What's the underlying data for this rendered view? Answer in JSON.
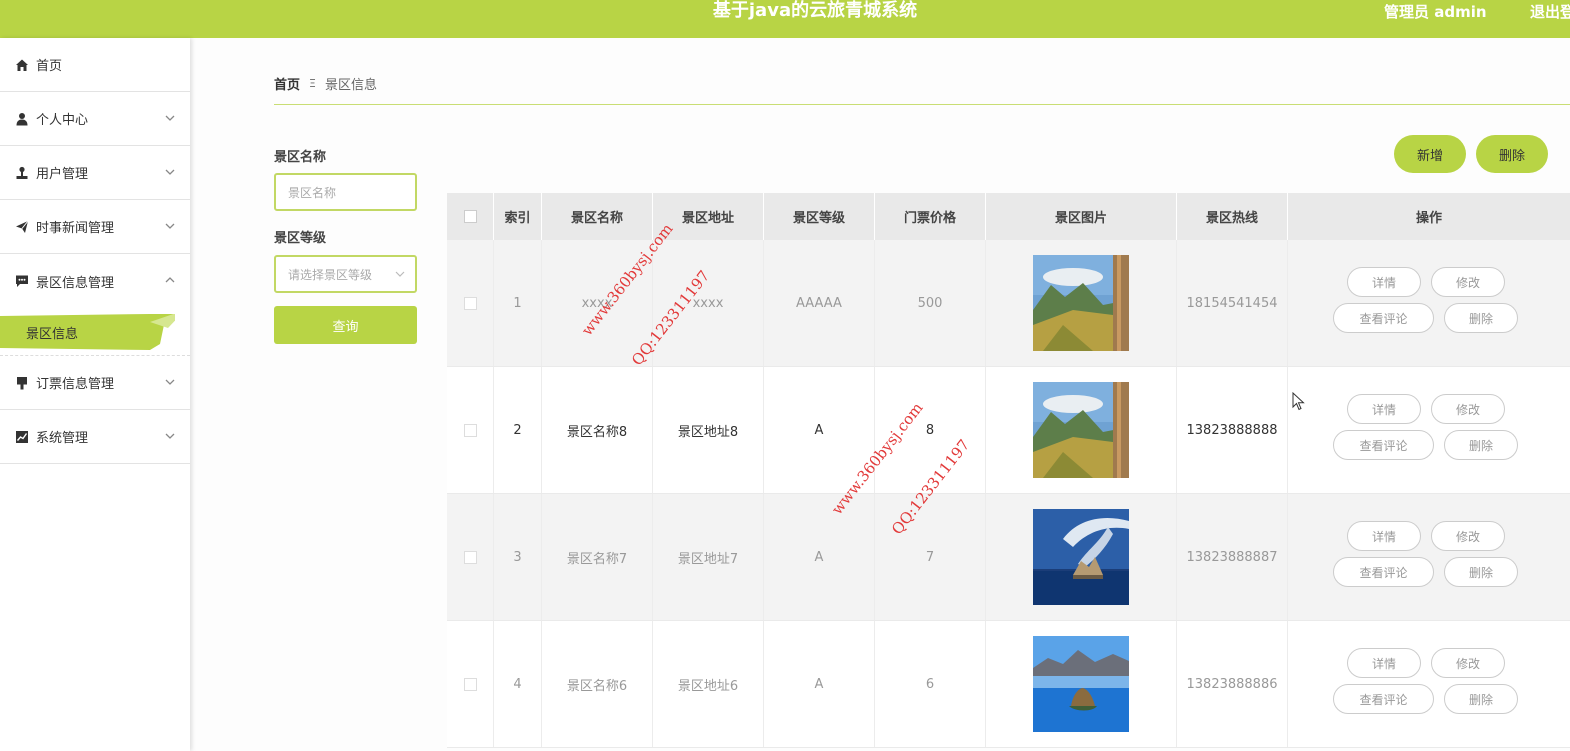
{
  "header": {
    "title": "基于java的云旅青城系统",
    "admin": "管理员 admin",
    "logout": "退出登"
  },
  "sidebar": {
    "items": [
      {
        "label": "首页",
        "icon": "home-icon"
      },
      {
        "label": "个人中心",
        "icon": "user-icon"
      },
      {
        "label": "用户管理",
        "icon": "user-manage-icon"
      },
      {
        "label": "时事新闻管理",
        "icon": "paper-plane-icon"
      },
      {
        "label": "景区信息管理",
        "icon": "chat-icon"
      },
      {
        "label": "订票信息管理",
        "icon": "brush-icon"
      },
      {
        "label": "系统管理",
        "icon": "chart-icon"
      }
    ],
    "sub_active": "景区信息"
  },
  "breadcrumb": {
    "home": "首页",
    "separator": "Ξ",
    "current": "景区信息"
  },
  "search": {
    "name_label": "景区名称",
    "name_placeholder": "景区名称",
    "level_label": "景区等级",
    "level_placeholder": "请选择景区等级",
    "query_button": "查询"
  },
  "actions": {
    "add": "新增",
    "delete": "删除"
  },
  "table": {
    "headers": [
      "索引",
      "景区名称",
      "景区地址",
      "景区等级",
      "门票价格",
      "景区图片",
      "景区热线",
      "操作"
    ],
    "rows": [
      {
        "index": "1",
        "name": "xxxx",
        "address": "xxxx",
        "level": "AAAAA",
        "price": "500",
        "hotline": "18154541454"
      },
      {
        "index": "2",
        "name": "景区名称8",
        "address": "景区地址8",
        "level": "A",
        "price": "8",
        "hotline": "13823888888"
      },
      {
        "index": "3",
        "name": "景区名称7",
        "address": "景区地址7",
        "level": "A",
        "price": "7",
        "hotline": "13823888887"
      },
      {
        "index": "4",
        "name": "景区名称6",
        "address": "景区地址6",
        "level": "A",
        "price": "6",
        "hotline": "13823888886"
      }
    ],
    "ops": {
      "detail": "详情",
      "edit": "修改",
      "comments": "查看评论",
      "delete": "删除"
    }
  },
  "watermark": {
    "site": "www.360bysj.com",
    "qq": "QQ:123311197"
  },
  "colors": {
    "accent": "#b8d445",
    "border": "#c2d864",
    "watermark": "#e23a3a"
  }
}
